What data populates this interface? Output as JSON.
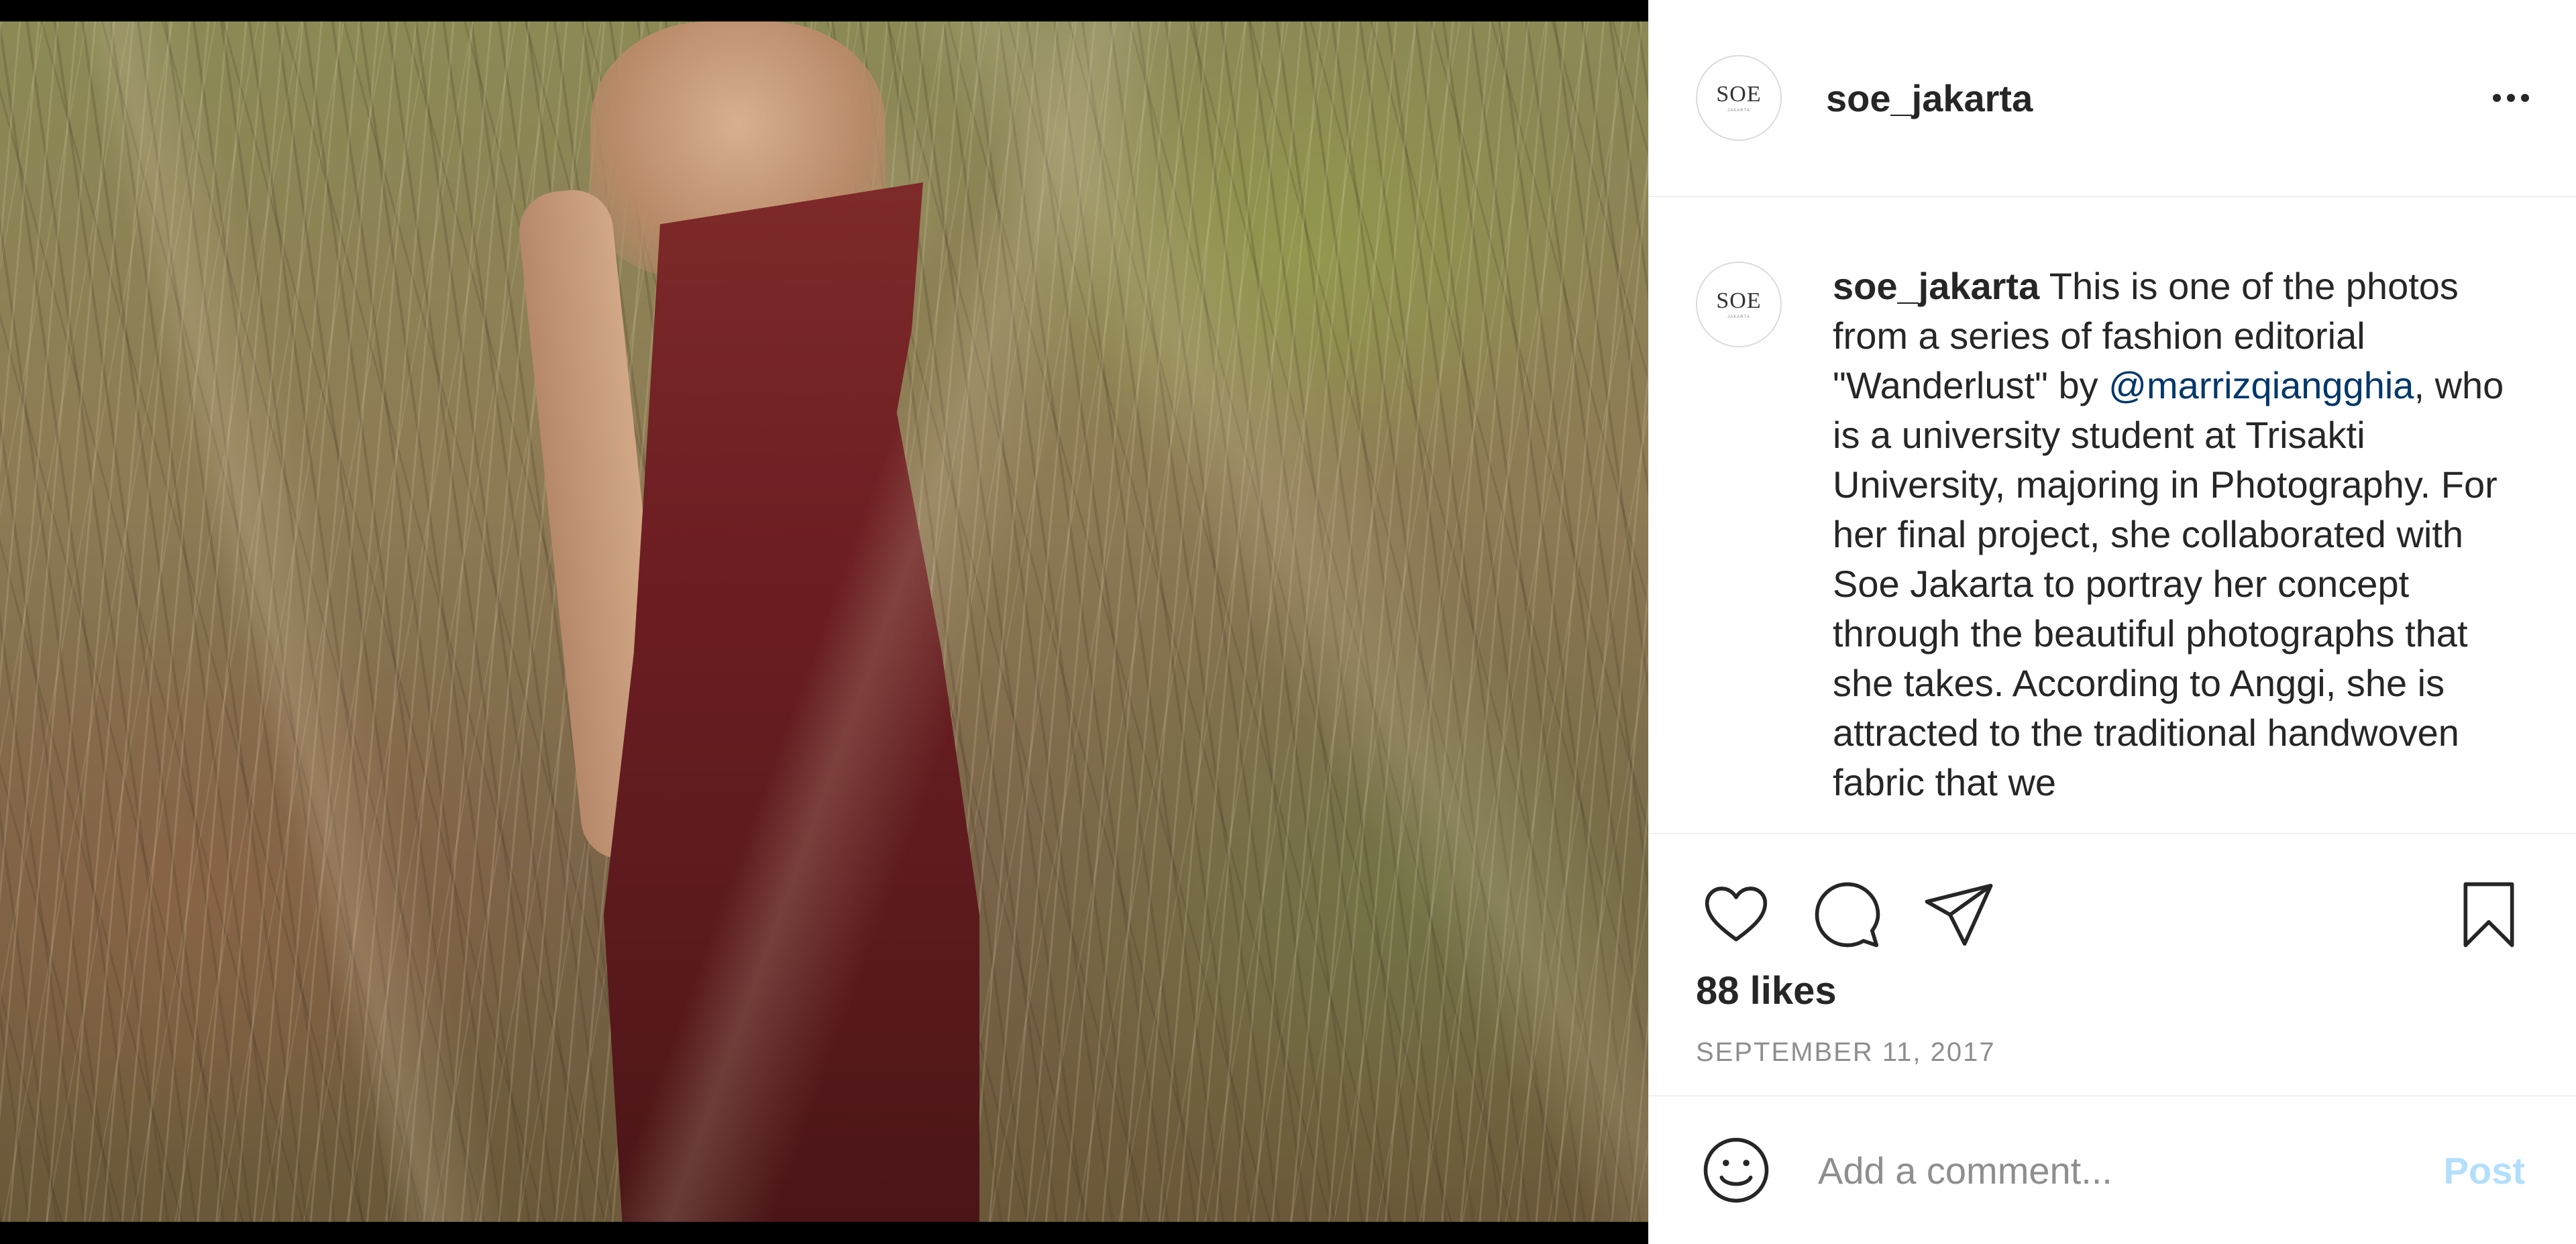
{
  "post": {
    "username": "soe_jakarta",
    "avatar_text": "SOE",
    "avatar_subtext": "JAKARTA",
    "more_icon": "more-horizontal-icon"
  },
  "caption": {
    "username": "soe_jakarta",
    "text_before_mention": " This is one of the photos from a series of fashion editorial \"Wanderlust\" by ",
    "mention": "@marrizqiangghia",
    "text_after_mention": ", who is a university student at Trisakti University, majoring in Photography. For her final project, she collaborated with Soe Jakarta to portray her concept through the beautiful photographs that she takes. According to Anggi, she is attracted to the traditional handwoven fabric that we"
  },
  "actions": {
    "like_icon": "heart-icon",
    "comment_icon": "comment-icon",
    "share_icon": "paper-plane-icon",
    "save_icon": "bookmark-icon"
  },
  "likes_text": "88 likes",
  "date_text": "SEPTEMBER 11, 2017",
  "comment": {
    "emoji_icon": "smiley-icon",
    "placeholder": "Add a comment...",
    "post_label": "Post"
  },
  "colors": {
    "text": "#262626",
    "secondary": "#8e8e8e",
    "mention": "#00376b",
    "post_disabled": "#b2dffc",
    "divider": "#efefef"
  }
}
